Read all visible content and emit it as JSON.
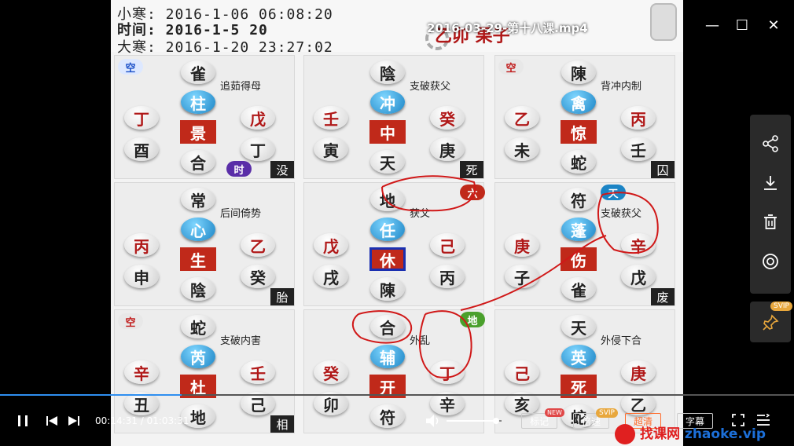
{
  "window": {
    "title": "2016-03-29-第十八课.mp4",
    "minimize_label": "—",
    "maximize_label": "☐",
    "close_label": "✕"
  },
  "video": {
    "header": {
      "line1": "小寒: 2016-1-06 06:08:20",
      "line2": "时间: 2016-1-5 20",
      "line3": "大寒: 2016-1-20 23:27:02",
      "brand": "乙卯 果子"
    },
    "palaces": [
      {
        "top": "雀",
        "star": "柱",
        "men": "景",
        "bottom": "合",
        "tl": "丁",
        "tr": "戊",
        "bl": "酉",
        "br": "丁",
        "note": "追茹得母",
        "badge": "空",
        "tag": "时",
        "corner": "没"
      },
      {
        "top": "陰",
        "star": "冲",
        "men": "中",
        "bottom": "天",
        "tl": "壬",
        "tr": "癸",
        "bl": "寅",
        "br": "庚",
        "note": "支破获父",
        "corner": "死"
      },
      {
        "top": "陳",
        "star": "禽",
        "men": "惊",
        "bottom": "蛇",
        "tl": "乙",
        "tr": "丙",
        "bl": "未",
        "br": "壬",
        "note": "背冲内制",
        "badge": "空",
        "corner": "囚"
      },
      {
        "top": "常",
        "star": "心",
        "men": "生",
        "bottom": "陰",
        "tl": "丙",
        "tr": "乙",
        "bl": "申",
        "br": "癸",
        "note": "后间倚势",
        "corner": "胎"
      },
      {
        "top": "地",
        "star": "任",
        "men": "休",
        "bottom": "陳",
        "tl": "戊",
        "tr": "己",
        "bl": "戌",
        "br": "丙",
        "note": "获父",
        "tag": "六"
      },
      {
        "top": "符",
        "star": "蓬",
        "men": "伤",
        "bottom": "雀",
        "tl": "庚",
        "tr": "辛",
        "bl": "子",
        "br": "戊",
        "note": "支破获父",
        "tag": "天",
        "corner": "废"
      },
      {
        "top": "蛇",
        "star": "芮",
        "men": "杜",
        "bottom": "地",
        "tl": "辛",
        "tr": "壬",
        "bl": "丑",
        "br": "己",
        "note": "支破内害",
        "badge": "空",
        "corner": "相"
      },
      {
        "top": "合",
        "star": "辅",
        "men": "开",
        "bottom": "符",
        "tl": "癸",
        "tr": "丁",
        "bl": "卯",
        "br": "辛",
        "note": "外乱",
        "tag": "地"
      },
      {
        "top": "天",
        "star": "英",
        "men": "死",
        "bottom": "蛇",
        "tl": "己",
        "tr": "庚",
        "bl": "亥",
        "br": "乙",
        "note": "外侵下合"
      }
    ]
  },
  "player": {
    "current_time": "00:14:31",
    "separator": " / ",
    "total_time": "01:03:31",
    "progress": 0.229,
    "volume": 0.9,
    "buttons": {
      "mark": "标记",
      "mark_badge": "NEW",
      "speed": "倍速",
      "speed_badge": "SVIP",
      "quality": "超清",
      "subtitle": "字幕"
    },
    "icons": {
      "pause": "pause-icon",
      "prev": "previous-icon",
      "next": "next-icon",
      "volume": "volume-icon",
      "fullscreen": "fullscreen-icon",
      "playlist": "playlist-icon"
    }
  },
  "side_panel": {
    "items": [
      "share-icon",
      "download-icon",
      "delete-icon",
      "circle-icon"
    ],
    "pin_badge": "SVIP"
  },
  "watermark": {
    "cn": "找课网",
    "en": "zhaoke.vip"
  }
}
